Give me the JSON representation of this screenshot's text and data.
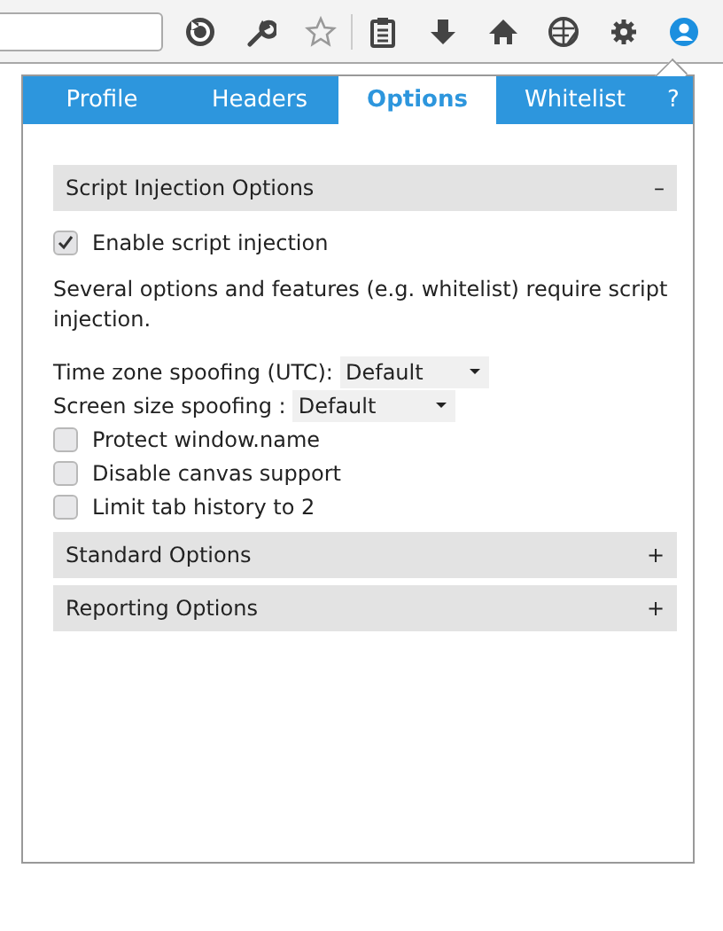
{
  "tabs": [
    {
      "label": "Profile",
      "selected": false
    },
    {
      "label": "Headers",
      "selected": false
    },
    {
      "label": "Options",
      "selected": true
    },
    {
      "label": "Whitelist",
      "selected": false
    },
    {
      "label": "?",
      "selected": false
    }
  ],
  "sections": [
    {
      "title": "Script Injection Options",
      "toggle": "–",
      "items": [
        {
          "kind": "checkbox",
          "label": "Enable script injection",
          "checked": true
        },
        {
          "kind": "text",
          "text": "Several options and features (e.g. whitelist) require script injection."
        },
        {
          "kind": "select",
          "label": "Time zone spoofing (UTC):",
          "value": "Default"
        },
        {
          "kind": "select",
          "label": "Screen size spoofing :",
          "value": "Default"
        },
        {
          "kind": "checkbox",
          "label": "Protect window.name",
          "checked": false
        },
        {
          "kind": "checkbox",
          "label": "Disable canvas support",
          "checked": false
        },
        {
          "kind": "checkbox",
          "label": "Limit tab history to 2",
          "checked": false
        }
      ]
    },
    {
      "title": "Standard Options",
      "toggle": "+"
    },
    {
      "title": "Reporting Options",
      "toggle": "+"
    }
  ]
}
